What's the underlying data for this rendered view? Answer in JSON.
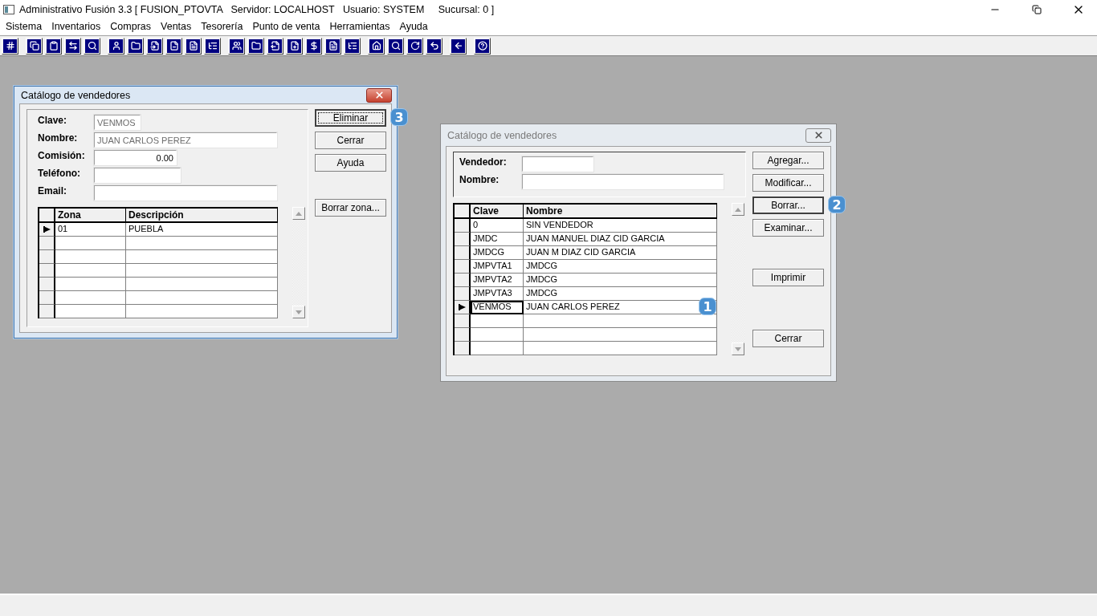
{
  "window": {
    "title": "Administrativo Fusión 3.3 [ FUSION_PTOVTA   Servidor: LOCALHOST   Usuario: SYSTEM     Sucursal: 0 ]"
  },
  "menu": [
    "Sistema",
    "Inventarios",
    "Compras",
    "Ventas",
    "Tesorería",
    "Punto de venta",
    "Herramientas",
    "Ayuda"
  ],
  "edit_dialog": {
    "title": "Catálogo de vendedores",
    "active": true,
    "fields": [
      {
        "label": "Clave:",
        "value": "VENMOS",
        "disabled": true,
        "kind": "text"
      },
      {
        "label": "Nombre:",
        "value": "JUAN CARLOS PEREZ",
        "disabled": true,
        "kind": "text"
      },
      {
        "label": "Comisión:",
        "value": "0.00",
        "disabled": false,
        "kind": "number"
      },
      {
        "label": "Teléfono:",
        "kind": "text"
      },
      {
        "label": "Email:",
        "kind": "text"
      }
    ],
    "grid": {
      "columns": [
        "Zona",
        "Descripción"
      ],
      "rows": [
        {
          "cells": [
            "01",
            "PUEBLA"
          ],
          "selected": true
        }
      ]
    },
    "buttons": [
      {
        "label": "Eliminar",
        "default": true,
        "focused": true,
        "badge": "3"
      },
      {
        "label": "Cerrar",
        "default": false,
        "focused": false
      },
      {
        "label": "Ayuda",
        "default": false,
        "focused": false
      },
      {
        "label": "Borrar zona...",
        "default": false,
        "focused": false
      }
    ]
  },
  "list_dialog": {
    "title": "Catálogo de vendedores",
    "active": false,
    "filters": [
      {
        "label": "Vendedor:",
        "kind": "short"
      },
      {
        "label": "Nombre:",
        "kind": "long"
      }
    ],
    "grid": {
      "columns": [
        "Clave",
        "Nombre"
      ],
      "rows": [
        {
          "cells": [
            "0",
            "SIN VENDEDOR"
          ],
          "selected": false
        },
        {
          "cells": [
            "JMDC",
            "JUAN MANUEL DIAZ CID GARCIA"
          ],
          "selected": false
        },
        {
          "cells": [
            "JMDCG",
            "JUAN M DIAZ CID GARCIA"
          ],
          "selected": false
        },
        {
          "cells": [
            "JMPVTA1",
            "JMDCG"
          ],
          "selected": false
        },
        {
          "cells": [
            "JMPVTA2",
            "JMDCG"
          ],
          "selected": false
        },
        {
          "cells": [
            "JMPVTA3",
            "JMDCG"
          ],
          "selected": false
        },
        {
          "cells": [
            "VENMOS",
            "JUAN CARLOS PEREZ"
          ],
          "selected": true,
          "badge": "1"
        }
      ]
    },
    "buttons": [
      {
        "label": "Agregar...",
        "default": false,
        "focused": false
      },
      {
        "label": "Modificar...",
        "default": false,
        "focused": false
      },
      {
        "label": "Borrar...",
        "default": true,
        "focused": false,
        "badge": "2"
      },
      {
        "label": "Examinar...",
        "default": false,
        "focused": false
      },
      {
        "label": "Imprimir",
        "default": false,
        "focused": false
      },
      {
        "label": "Cerrar",
        "default": false,
        "focused": false
      }
    ]
  }
}
